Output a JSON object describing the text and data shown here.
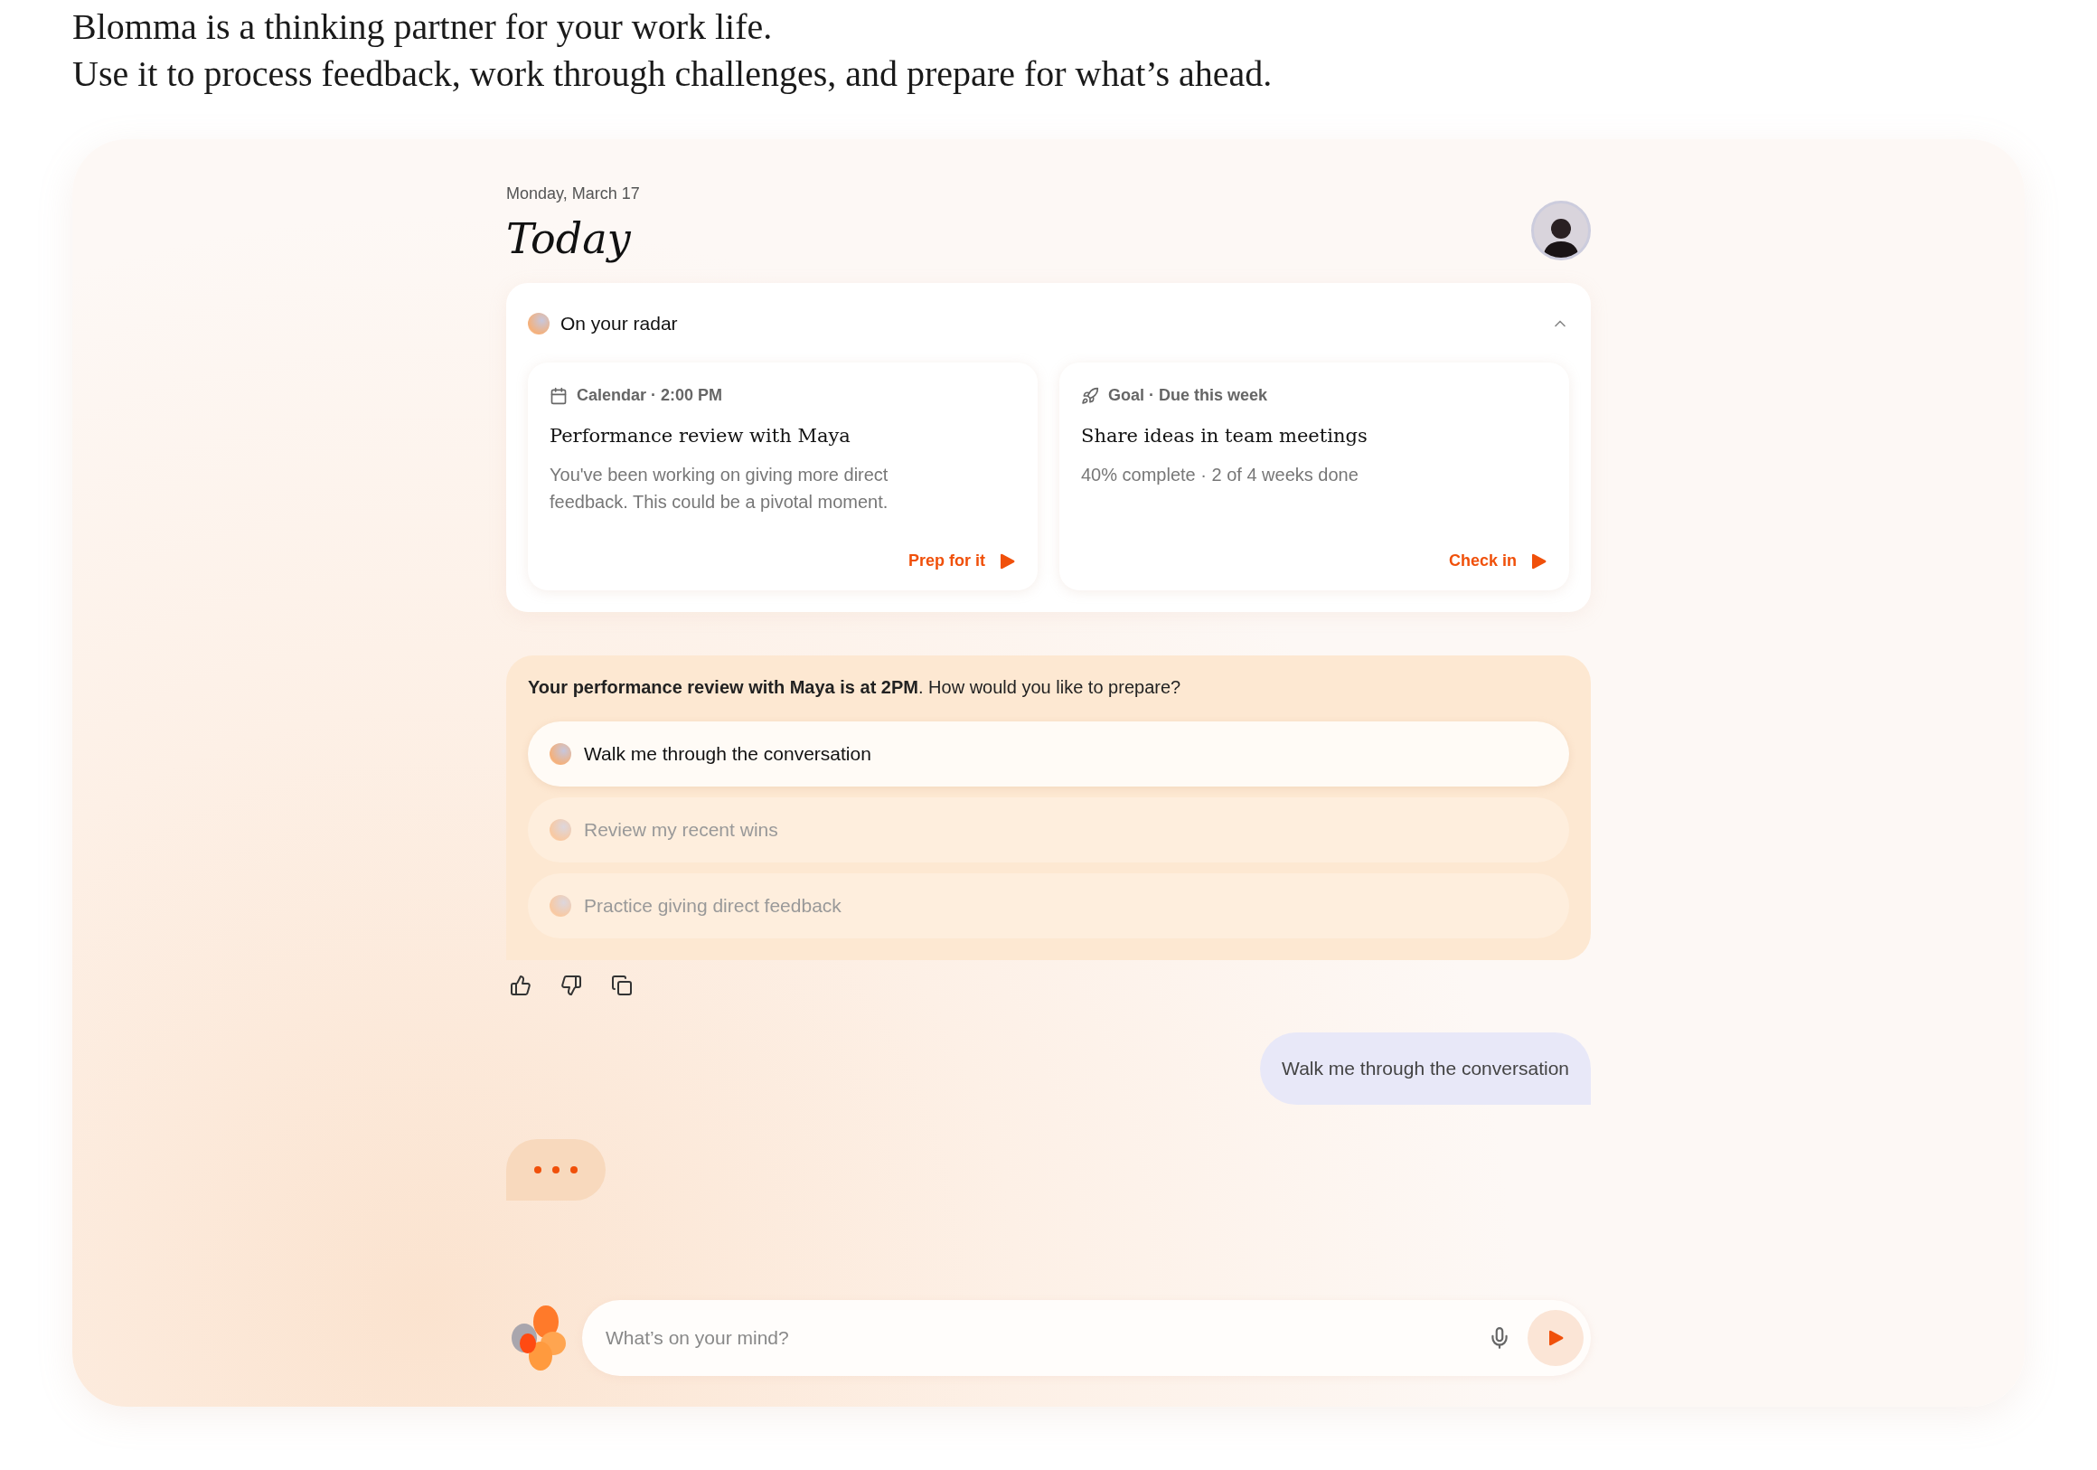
{
  "intro": [
    "Blomma is a thinking partner for your work life.",
    "Use it to process feedback, work through challenges, and prepare for what’s ahead."
  ],
  "header": {
    "date": "Monday, March 17",
    "title": "Today"
  },
  "radar": {
    "title": "On your radar",
    "expanded": true,
    "cards": [
      {
        "kind": "calendar",
        "meta": "Calendar · 2:00 PM",
        "title": "Performance review with Maya",
        "body": "You've been working on giving more direct feedback. This could be a pivotal moment.",
        "action": "Prep for it"
      },
      {
        "kind": "goal",
        "meta": "Goal · Due this week",
        "title": "Share ideas in team meetings",
        "body": "40% complete · 2 of 4 weeks done",
        "action": "Check in"
      }
    ]
  },
  "prompt": {
    "text": "**Your performance review with Maya is at 2PM**. How would you like to prepare?",
    "options": [
      {
        "label": "Walk me through the conversation",
        "selected": true
      },
      {
        "label": "Review my recent wins",
        "selected": false
      },
      {
        "label": "Practice giving direct feedback",
        "selected": false
      }
    ]
  },
  "user_message": "Walk me through the conversation",
  "typing": true,
  "composer": {
    "placeholder": "What’s on your mind?"
  }
}
